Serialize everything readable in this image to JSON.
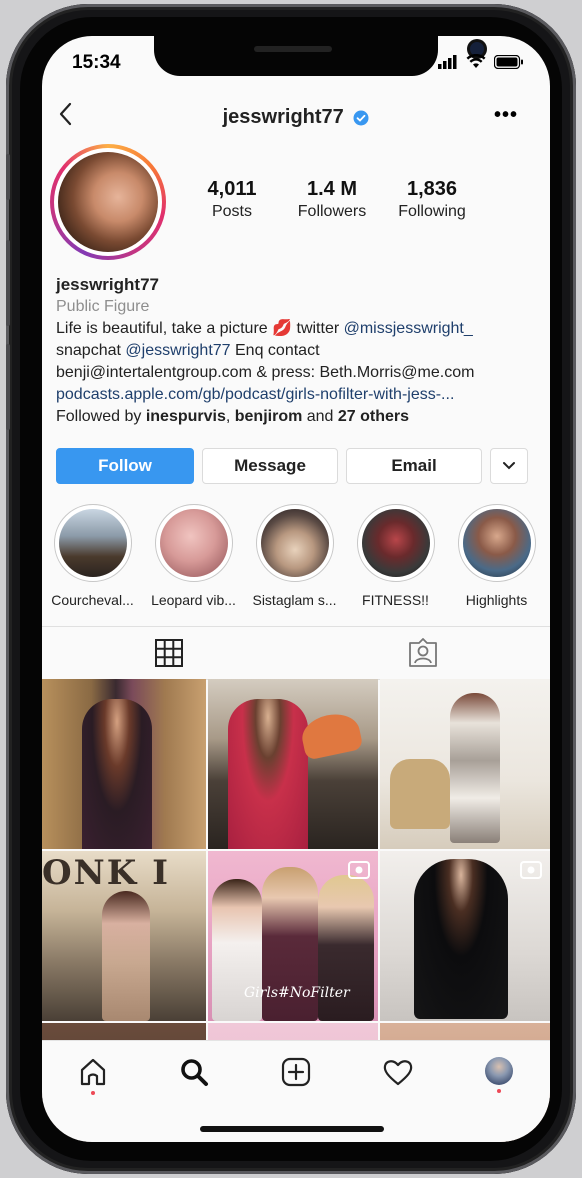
{
  "status": {
    "time": "15:34"
  },
  "header": {
    "username": "jesswright77"
  },
  "profile": {
    "stats": [
      {
        "value": "4,011",
        "label": "Posts"
      },
      {
        "value": "1.4 M",
        "label": "Followers"
      },
      {
        "value": "1,836",
        "label": "Following"
      }
    ],
    "name": "jesswright77",
    "category": "Public Figure",
    "bio_line1_text": "Life is beautiful, take a picture 💋 twitter ",
    "bio_line1_link": "@missjesswright_",
    "bio_line2_text": "snapchat ",
    "bio_line2_link": "@jesswright77",
    "bio_line2_rest": " Enq contact",
    "bio_line3": "benji@intertalentgroup.com & press: Beth.Morris@me.com",
    "website": "podcasts.apple.com/gb/podcast/girls-nofilter-with-jess-...",
    "followed_prefix": "Followed by ",
    "followed_user1": "inespurvis",
    "followed_sep": ", ",
    "followed_user2": "benjirom",
    "followed_and": " and ",
    "followed_others": "27 others"
  },
  "actions": {
    "follow": "Follow",
    "message": "Message",
    "email": "Email"
  },
  "highlights": [
    {
      "label": "Courcheval..."
    },
    {
      "label": "Leopard vib..."
    },
    {
      "label": "Sistaglam s..."
    },
    {
      "label": "FITNESS!!"
    },
    {
      "label": "Highlights"
    }
  ],
  "posts": {
    "post1_text": "ONK I",
    "post5_text": "Girls#NoFilter"
  },
  "colors": {
    "accent": "#3897f0",
    "link": "#1f3f6c",
    "notification": "#ed4956"
  },
  "icons": [
    "back-icon",
    "verified-icon",
    "more-icon",
    "grid-icon",
    "tagged-icon",
    "home-icon",
    "search-icon",
    "add-icon",
    "heart-icon",
    "profile-icon",
    "video-icon"
  ]
}
